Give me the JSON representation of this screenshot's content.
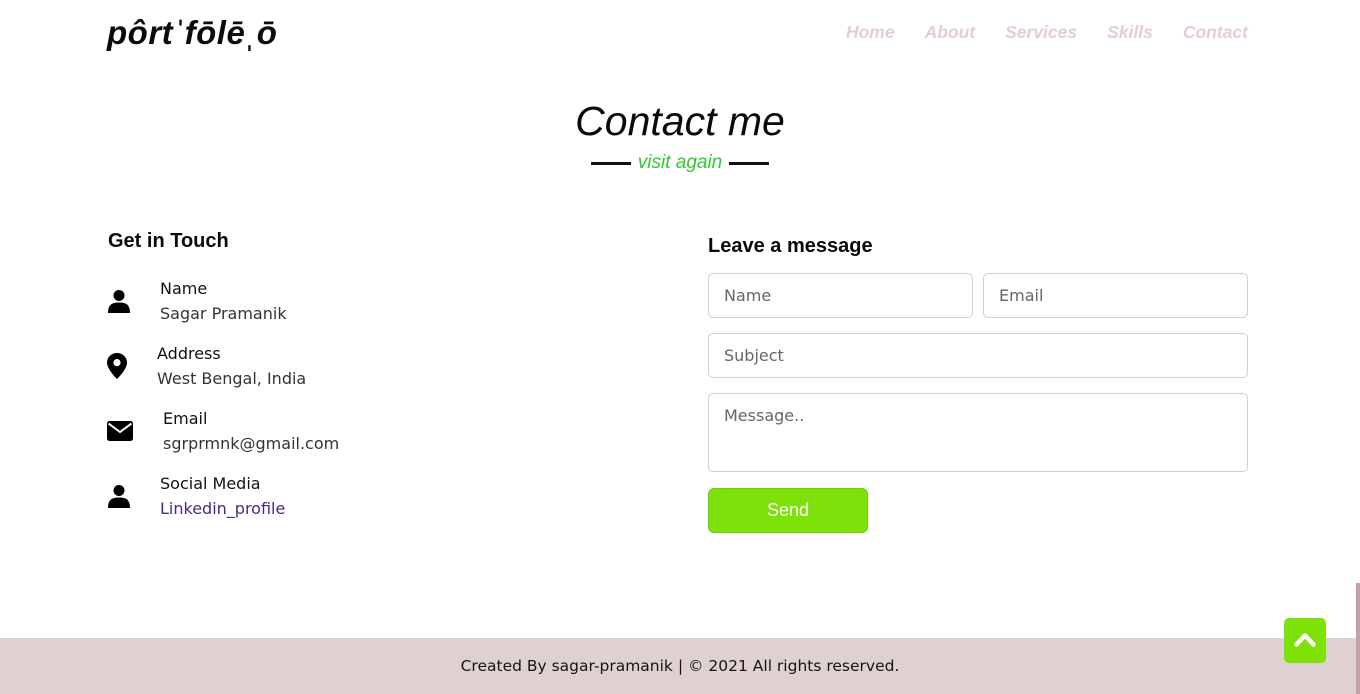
{
  "navbar": {
    "logo": "pôrtˈfōlēˌō",
    "menu": [
      "Home",
      "About",
      "Services",
      "Skills",
      "Contact"
    ]
  },
  "heading": {
    "title": "Contact me",
    "subtitle": "visit again"
  },
  "contact_info": {
    "title": "Get in Touch",
    "items": [
      {
        "label": "Name",
        "value": "Sagar Pramanik",
        "icon": "user-icon"
      },
      {
        "label": "Address",
        "value": "West Bengal, India",
        "icon": "map-marker-icon"
      },
      {
        "label": "Email",
        "value": "sgrprmnk@gmail.com",
        "icon": "envelope-icon"
      },
      {
        "label": "Social Media",
        "value": "Linkedin_profile",
        "icon": "user-icon"
      }
    ]
  },
  "message_form": {
    "title": "Leave a message",
    "name_placeholder": "Name",
    "email_placeholder": "Email",
    "subject_placeholder": "Subject",
    "message_placeholder": "Message..",
    "send_label": "Send"
  },
  "footer": {
    "text": "Created By sagar-pramanik | © 2021 All rights reserved."
  },
  "colors": {
    "accent_green": "#7ee20a",
    "subtitle_green": "#2ecc2e",
    "nav_text": "#e2cfd0",
    "footer_bg": "#dfd0d1"
  }
}
